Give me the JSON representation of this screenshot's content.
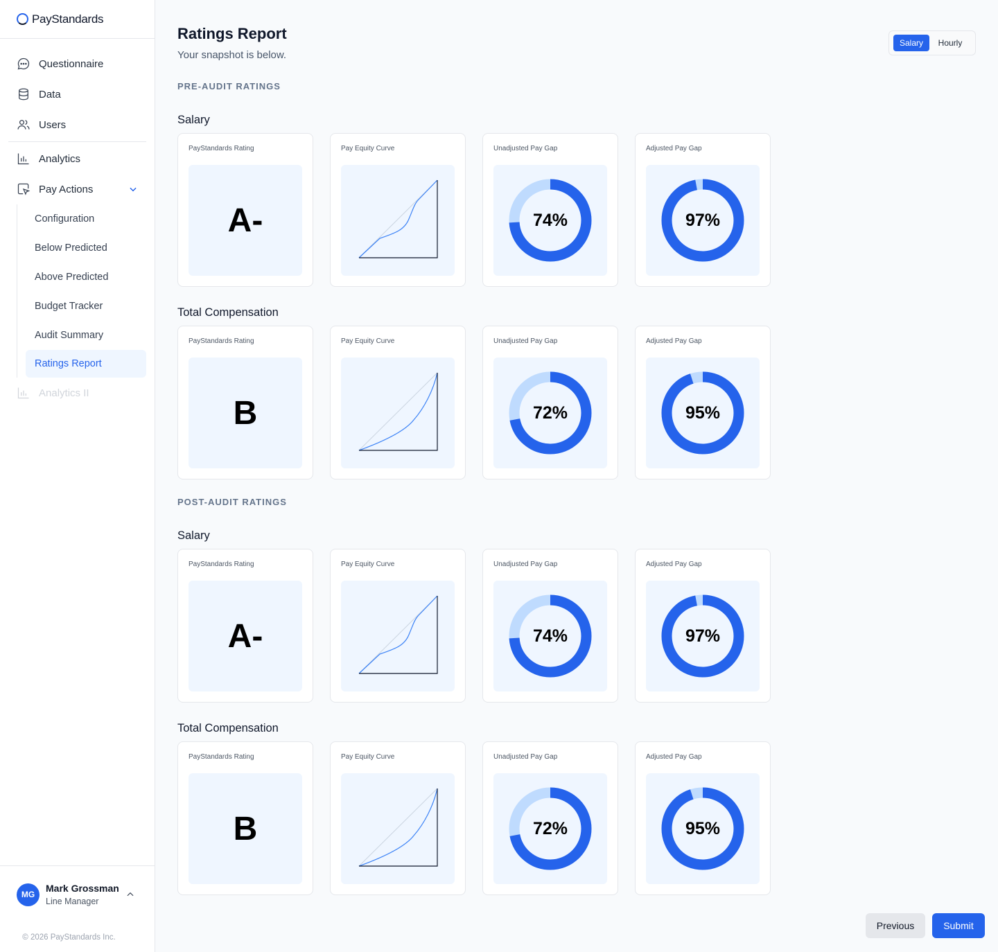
{
  "app": {
    "logo_text": "PayStandards"
  },
  "sidebar": {
    "items": [
      {
        "label": "Questionnaire",
        "icon": "chat-bubble-icon"
      },
      {
        "label": "Data",
        "icon": "database-icon"
      },
      {
        "label": "Users",
        "icon": "users-icon"
      },
      {
        "label": "Analytics",
        "icon": "bar-chart-icon"
      },
      {
        "label": "Pay Actions",
        "icon": "cursor-click-icon",
        "expanded": true
      }
    ],
    "sub_items": [
      {
        "label": "Configuration"
      },
      {
        "label": "Below Predicted"
      },
      {
        "label": "Above Predicted"
      },
      {
        "label": "Budget Tracker"
      },
      {
        "label": "Audit Summary"
      },
      {
        "label": "Ratings Report",
        "active": true
      }
    ],
    "disabled_item": {
      "label": "Analytics II",
      "icon": "bar-chart-icon"
    }
  },
  "user": {
    "initials": "MG",
    "name": "Mark Grossman",
    "role": "Line Manager"
  },
  "copyright": "© 2026 PayStandards Inc.",
  "header": {
    "title": "Ratings Report",
    "subtitle": "Your snapshot is below."
  },
  "toggle": {
    "options": [
      "Salary",
      "Hourly"
    ],
    "selected": "Salary"
  },
  "card_labels": {
    "rating": "PayStandards Rating",
    "curve": "Pay Equity Curve",
    "unadjusted": "Unadjusted Pay Gap",
    "adjusted": "Adjusted Pay Gap"
  },
  "sections": [
    {
      "label": "PRE-AUDIT RATINGS",
      "groups": [
        {
          "title": "Salary",
          "rating": "A-",
          "unadjusted": "74%",
          "unadjusted_value": 74,
          "adjusted": "97%",
          "adjusted_value": 97
        },
        {
          "title": "Total Compensation",
          "rating": "B",
          "unadjusted": "72%",
          "unadjusted_value": 72,
          "adjusted": "95%",
          "adjusted_value": 95
        }
      ]
    },
    {
      "label": "POST-AUDIT RATINGS",
      "groups": [
        {
          "title": "Salary",
          "rating": "A-",
          "unadjusted": "74%",
          "unadjusted_value": 74,
          "adjusted": "97%",
          "adjusted_value": 97
        },
        {
          "title": "Total Compensation",
          "rating": "B",
          "unadjusted": "72%",
          "unadjusted_value": 72,
          "adjusted": "95%",
          "adjusted_value": 95
        }
      ]
    }
  ],
  "colors": {
    "accent": "#2563eb",
    "accent_light": "#bfdbfe",
    "card_bg": "#eff6ff"
  },
  "buttons": {
    "previous": "Previous",
    "submit": "Submit"
  }
}
